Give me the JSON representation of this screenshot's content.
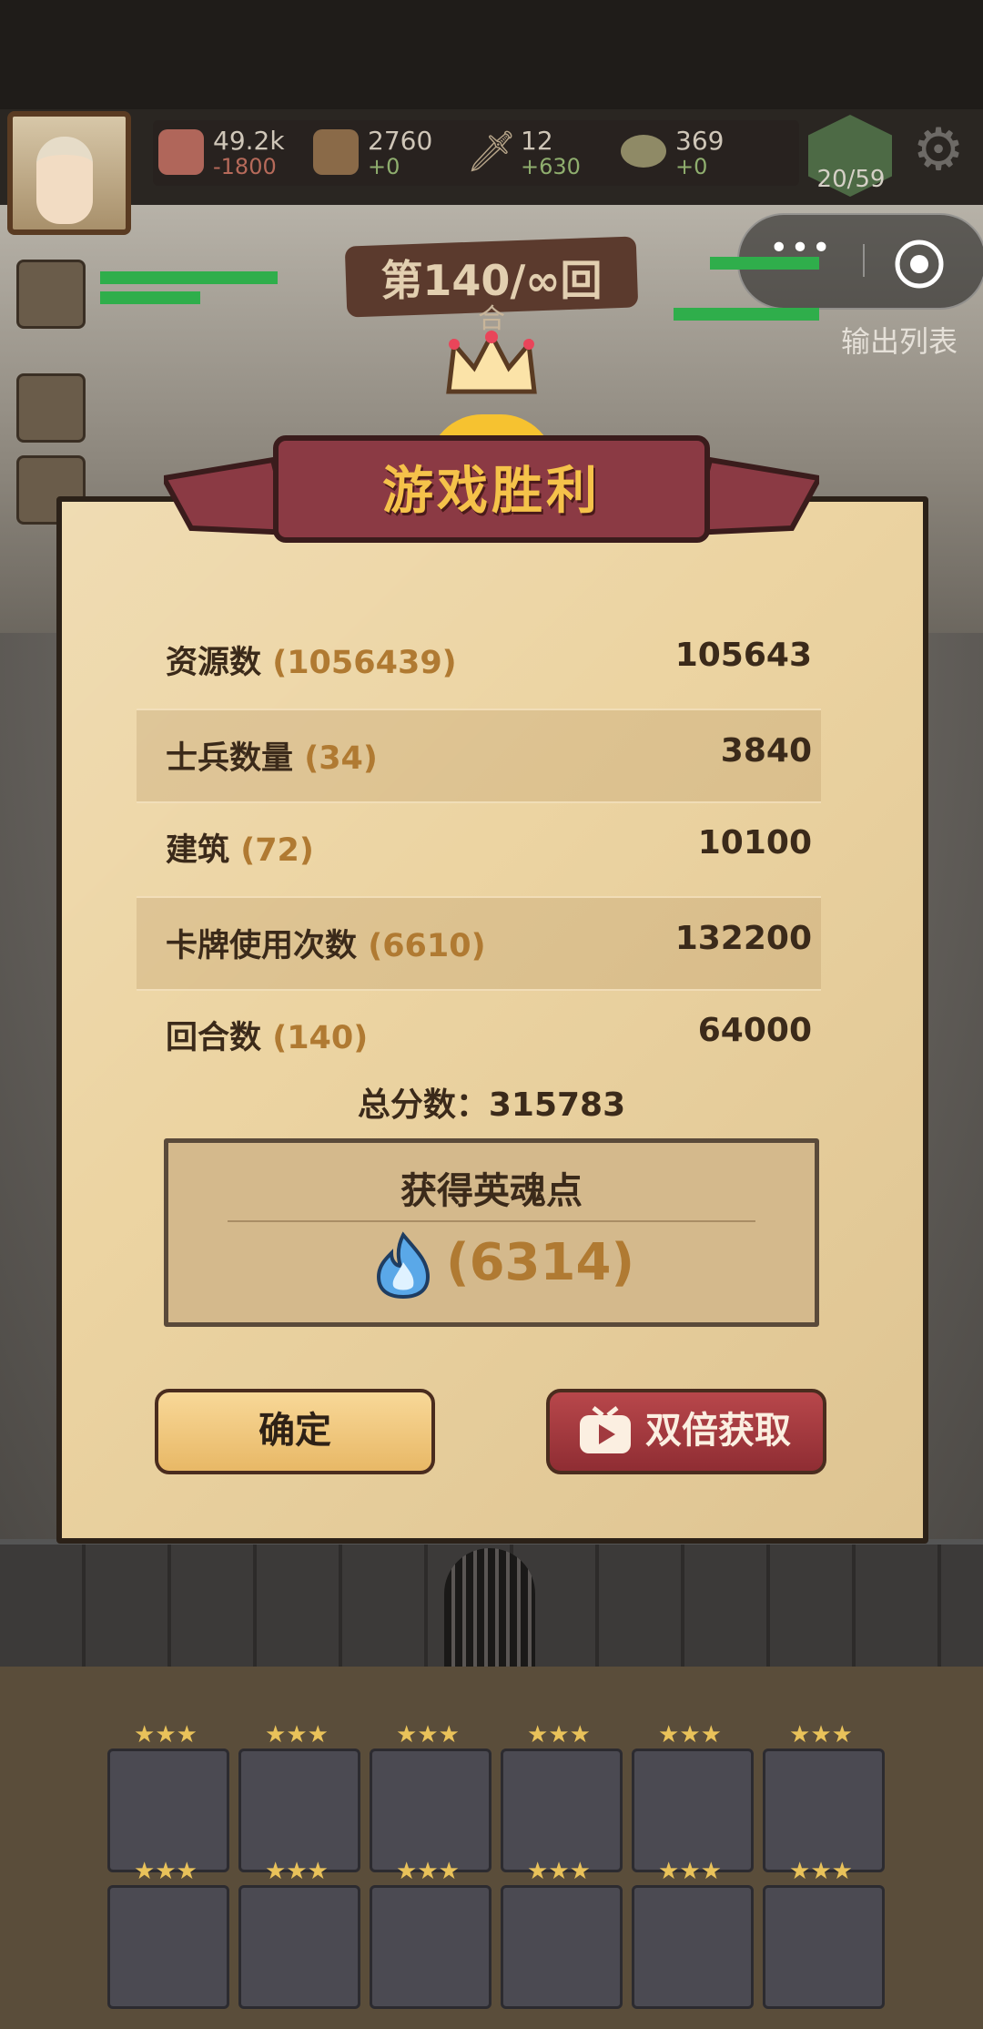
{
  "hud": {
    "resources": [
      {
        "icon": "meat-icon",
        "value": "49.2k",
        "delta": "-1800",
        "delta_color": "#b66a5a"
      },
      {
        "icon": "wood-icon",
        "value": "2760",
        "delta": "+0",
        "delta_color": "#8fae6e"
      },
      {
        "icon": "sword-icon",
        "value": "12",
        "delta": "+630",
        "delta_color": "#8fae6e"
      },
      {
        "icon": "coin-icon",
        "value": "369",
        "delta": "+0",
        "delta_color": "#8fae6e"
      }
    ],
    "population": "20/59"
  },
  "battle": {
    "round_label": "第140/∞回",
    "round_label_tail": "合",
    "output_list": "输出列表"
  },
  "dialog": {
    "title": "游戏胜利",
    "rows": [
      {
        "label": "资源数",
        "count": "(1056439)",
        "value": "105643"
      },
      {
        "label": "士兵数量",
        "count": "(34)",
        "value": "3840"
      },
      {
        "label": "建筑",
        "count": "(72)",
        "value": "10100"
      },
      {
        "label": "卡牌使用次数",
        "count": "(6610)",
        "value": "132200"
      },
      {
        "label": "回合数",
        "count": "(140)",
        "value": "64000"
      }
    ],
    "total": "总分数：315783",
    "soul_title": "获得英魂点",
    "soul_value": "(6314)",
    "confirm_label": "确定",
    "double_label": "双倍获取"
  },
  "colors": {
    "panel": "#ecd4a2",
    "ribbon": "#8b3a44",
    "title_text": "#f5c24a",
    "accent_number": "#b07a32"
  }
}
